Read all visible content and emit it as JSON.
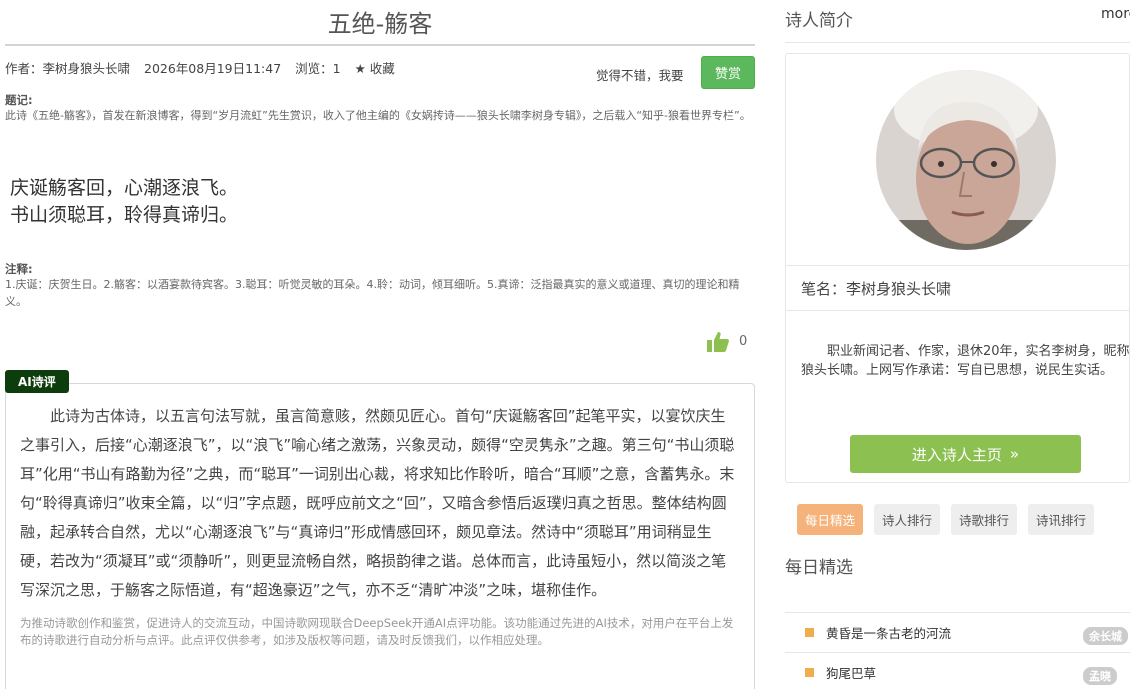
{
  "poem": {
    "title": "五绝-觞客",
    "meta": {
      "author": "作者：李树身狼头长啸",
      "datetime": "2026年08月19日11:47",
      "views": "浏览：1",
      "favorite": "收藏"
    },
    "appreciate_text": "觉得不错，我要",
    "reward_label": "赞赏",
    "preface_label": "题记:",
    "preface_text": "此诗《五绝-觞客》，首发在新浪博客，得到“岁月流虹”先生赏识，收入了他主编的《女娲抟诗——狼头长啸李树身专辑》，之后载入“知乎-狼看世界专栏”。",
    "lines": [
      "庆诞觞客回，心潮逐浪飞。",
      "书山须聪耳，聆得真谛归。"
    ],
    "notes_label": "注释:",
    "notes_text": "1.庆诞：庆贺生日。2.觞客：以酒宴款待宾客。3.聪耳：听觉灵敏的耳朵。4.聆：动词，倾耳细听。5.真谛：泛指最真实的意义或道理、真切的理论和精义。",
    "like_count": "0"
  },
  "ai_review": {
    "tag": "AI诗评",
    "body": "此诗为古体诗，以五言句法写就，虽言简意赅，然颇见匠心。首句“庆诞觞客回”起笔平实，以宴饮庆生之事引入，后接“心潮逐浪飞”，以“浪飞”喻心绪之激荡，兴象灵动，颇得“空灵隽永”之趣。第三句“书山须聪耳”化用“书山有路勤为径”之典，而“聪耳”一词别出心裁，将求知比作聆听，暗合“耳顺”之意，含蓄隽永。末句“聆得真谛归”收束全篇，以“归”字点题，既呼应前文之“回”，又暗含参悟后返璞归真之哲思。整体结构圆融，起承转合自然，尤以“心潮逐浪飞”与“真谛归”形成情感回环，颇见章法。然诗中“须聪耳”用词稍显生硬，若改为“须凝耳”或“须静听”，则更显流畅自然，略损韵律之谐。总体而言，此诗虽短小，然以简淡之笔写深沉之思，于觞客之际悟道，有“超逸豪迈”之气，亦不乏“清旷冲淡”之味，堪称佳作。",
    "note": "为推动诗歌创作和鉴赏，促进诗人的交流互动，中国诗歌网现联合DeepSeek开通AI点评功能。该功能通过先进的AI技术，对用户在平台上发布的诗歌进行自动分析与点评。此点评仅供参考，如涉及版权等问题，请及时反馈我们，以作相应处理。"
  },
  "sidebar": {
    "heading": "诗人简介",
    "more": "more",
    "penname": "笔名：李树身狼头长啸",
    "bio": "职业新闻记者、作家，退休20年，实名李树身，昵称狼头长啸。上网写作承诺：写自已思想，说民生实话。",
    "enter_label": "进入诗人主页",
    "tabs": [
      "每日精选",
      "诗人排行",
      "诗歌排行",
      "诗讯排行"
    ],
    "daily_heading": "每日精选",
    "daily_items": [
      {
        "title": "黄昏是一条古老的河流",
        "author": "余长城"
      },
      {
        "title": "狗尾巴草",
        "author": "孟晓"
      }
    ]
  },
  "colors": {
    "accent_green": "#5cb85c",
    "button_green": "#8cc152",
    "tag_dark_green": "#0d3d0d",
    "tab_active": "#f5b27a",
    "bullet_orange": "#f0ad4e"
  },
  "icons": [
    "star-icon",
    "thumbs-up-icon",
    "double-chevron-right-icon",
    "avatar-photo"
  ]
}
